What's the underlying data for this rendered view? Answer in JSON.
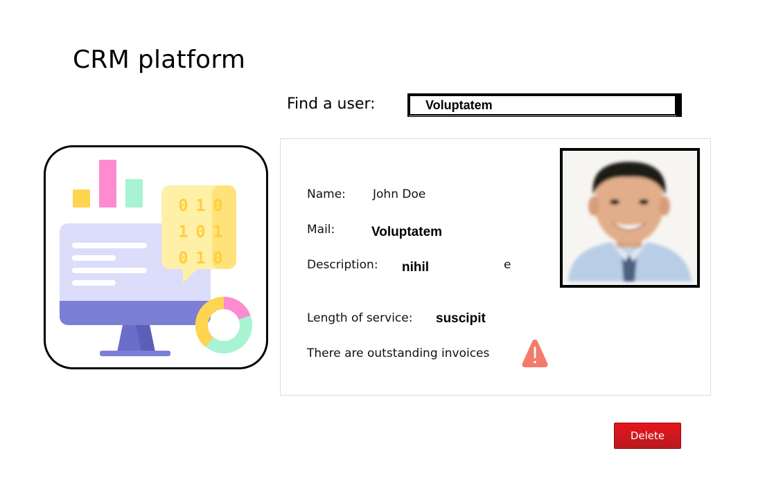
{
  "app": {
    "title": "CRM platform"
  },
  "search": {
    "label": "Find a user:",
    "value": "Voluptatem"
  },
  "user": {
    "name_label": "Name:",
    "name_value": "John Doe",
    "mail_label": "Mail:",
    "mail_value": "Voluptatem",
    "description_label": "Description:",
    "description_value": "nihil",
    "description_trailing": "e",
    "service_label": "Length of service:",
    "service_value": "suscipit",
    "invoice_warning": "There are outstanding invoices"
  },
  "binary_digits": [
    "0",
    "1",
    "0",
    "1",
    "0",
    "1",
    "0",
    "1",
    "0"
  ],
  "actions": {
    "delete_label": "Delete"
  },
  "colors": {
    "delete": "#d7161d",
    "warning": "#f47a6b",
    "accent_monitor": "#7b7fd4"
  },
  "icons": {
    "warning": "warning-triangle-icon",
    "illustration": "crm-dashboard-illustration",
    "photo": "user-avatar-photo"
  }
}
